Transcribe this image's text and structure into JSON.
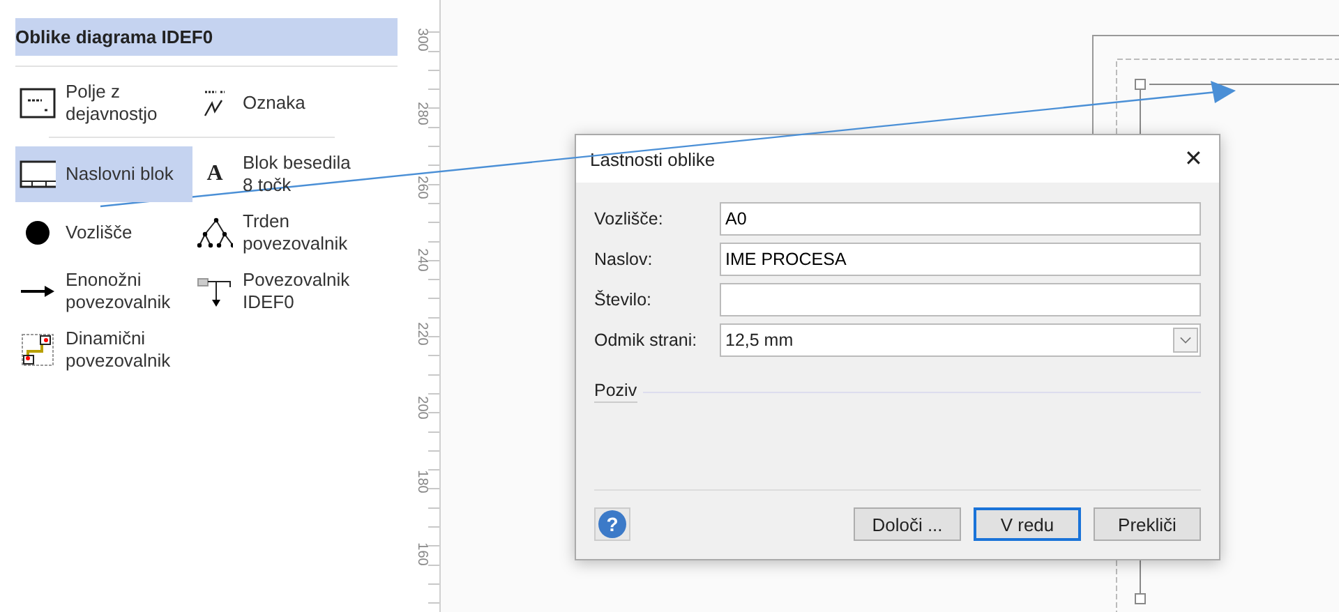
{
  "stencil": {
    "title": "Oblike diagrama IDEF0",
    "sections": [
      {
        "items": [
          {
            "label": "Polje z dejavnostjo",
            "selected": false
          },
          {
            "label": "Oznaka",
            "selected": false
          }
        ]
      },
      {
        "items": [
          {
            "label": "Naslovni blok",
            "selected": true
          },
          {
            "label": "Blok besedila 8 točk",
            "selected": false,
            "glyph": "A"
          },
          {
            "label": "Vozlišče",
            "selected": false
          },
          {
            "label": "Trden povezovalnik",
            "selected": false
          },
          {
            "label": "Enonožni povezovalnik",
            "selected": false
          },
          {
            "label": "Povezovalnik IDEF0",
            "selected": false
          },
          {
            "label": "Dinamični povezovalnik",
            "selected": false
          }
        ]
      }
    ]
  },
  "ruler": {
    "labels": [
      "300",
      "280",
      "260",
      "240",
      "220",
      "200",
      "180",
      "160"
    ]
  },
  "dialog": {
    "title": "Lastnosti oblike",
    "close": "✕",
    "fields": [
      {
        "label": "Vozlišče:",
        "value": "A0",
        "kind": "text"
      },
      {
        "label": "Naslov:",
        "value": "IME PROCESA",
        "kind": "text"
      },
      {
        "label": "Število:",
        "kind": "text"
      },
      {
        "label": "Odmik strani:",
        "value": "12,5 mm",
        "kind": "dropdown"
      }
    ],
    "section": "Poziv",
    "help": "?",
    "buttons": [
      {
        "label": "Določi ...",
        "focused": false
      },
      {
        "label": "V redu",
        "focused": true
      },
      {
        "label": "Prekliči",
        "focused": false
      }
    ]
  }
}
